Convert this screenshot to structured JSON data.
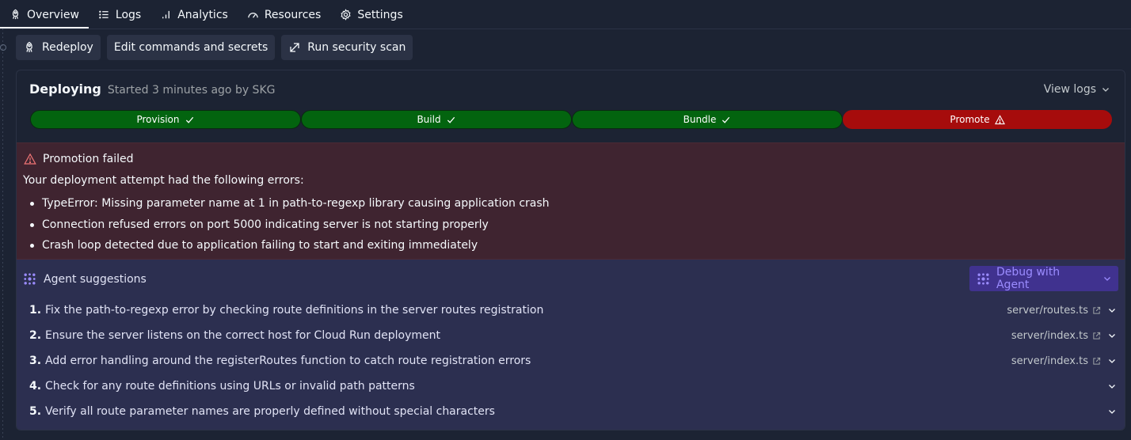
{
  "tabs": [
    {
      "label": "Overview",
      "icon": "deploy-icon",
      "active": true
    },
    {
      "label": "Logs",
      "icon": "list-icon"
    },
    {
      "label": "Analytics",
      "icon": "bar-chart-icon"
    },
    {
      "label": "Resources",
      "icon": "gauge-icon"
    },
    {
      "label": "Settings",
      "icon": "gear-icon"
    }
  ],
  "actions": {
    "redeploy": "Redeploy",
    "edit": "Edit commands and secrets",
    "scan": "Run security scan"
  },
  "deployment": {
    "status": "Deploying",
    "subtitle": "Started 3 minutes ago by SKG",
    "view_logs": "View logs",
    "steps": [
      {
        "label": "Provision",
        "state": "success"
      },
      {
        "label": "Build",
        "state": "success"
      },
      {
        "label": "Bundle",
        "state": "success"
      },
      {
        "label": "Promote",
        "state": "failed"
      }
    ]
  },
  "error": {
    "title": "Promotion failed",
    "intro": "Your deployment attempt had the following errors:",
    "items": [
      "TypeError: Missing parameter name at 1 in path-to-regexp library causing application crash",
      "Connection refused errors on port 5000 indicating server is not starting properly",
      "Crash loop detected due to application failing to start and exiting immediately"
    ]
  },
  "agent": {
    "title": "Agent suggestions",
    "debug_button": "Debug with Agent",
    "suggestions": [
      {
        "num": "1.",
        "text": "Fix the path-to-regexp error by checking route definitions in the server routes registration",
        "file": "server/routes.ts"
      },
      {
        "num": "2.",
        "text": "Ensure the server listens on the correct host for Cloud Run deployment",
        "file": "server/index.ts"
      },
      {
        "num": "3.",
        "text": "Add error handling around the registerRoutes function to catch route registration errors",
        "file": "server/index.ts"
      },
      {
        "num": "4.",
        "text": "Check for any route definitions using URLs or invalid path patterns",
        "file": ""
      },
      {
        "num": "5.",
        "text": "Verify all route parameter names are properly defined without special characters",
        "file": ""
      }
    ]
  },
  "colors": {
    "success": "#03640f",
    "failed": "#a60c0c",
    "error_bg": "#3f2430",
    "agent_bg": "#2c2f50",
    "agent_button": "#40328f"
  }
}
